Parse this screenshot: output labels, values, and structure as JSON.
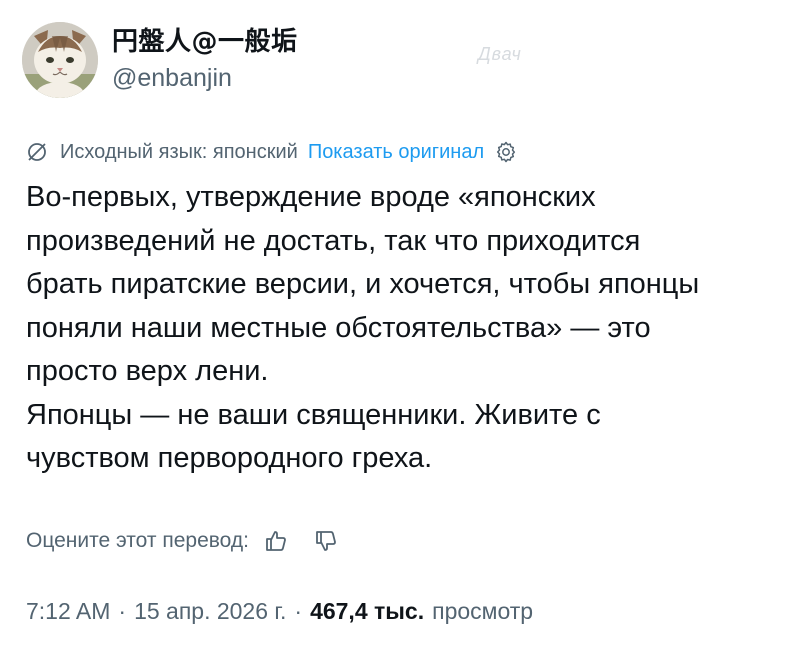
{
  "author": {
    "display_name": "円盤人@一般垢",
    "handle": "@enbanjin",
    "avatar_icon": "cat-avatar"
  },
  "watermark": "Двач",
  "translation": {
    "icon": "translate-icon",
    "source_language": "Исходный язык: японский",
    "show_original": "Показать оригинал",
    "settings_icon": "gear-icon"
  },
  "tweet": {
    "paragraph_1": "Во-первых, утверждение вроде «японских\nпроизведений не достать, так что приходится\nбрать пиратские версии, и хочется, чтобы японцы\nпоняли наши местные обстоятельства» — это\nпросто верх лени.",
    "paragraph_2": "Японцы — не ваши священники. Живите с\nчувством первородного греха."
  },
  "rating": {
    "label": "Оцените этот перевод:",
    "thumbs_up_icon": "thumbs-up-icon",
    "thumbs_down_icon": "thumbs-down-icon"
  },
  "meta": {
    "time": "7:12 AM",
    "separator": "·",
    "date": "15 апр. 2026 г.",
    "views_count": "467,4 тыс.",
    "views_label": "просмотр"
  },
  "colors": {
    "link": "#1d9bf0",
    "secondary_text": "#536471",
    "primary_text": "#0f1419"
  }
}
